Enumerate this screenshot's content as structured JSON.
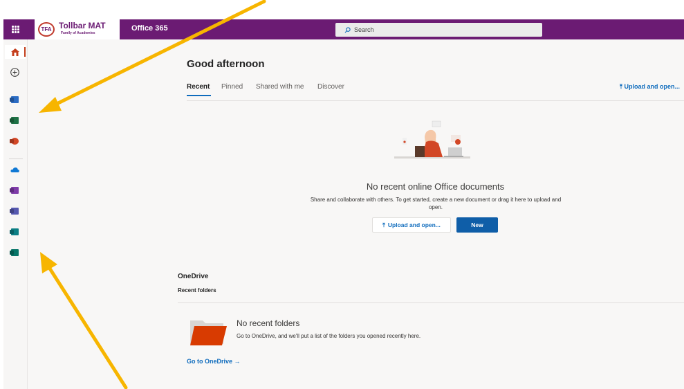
{
  "topbar": {
    "org_logo_text": "TFA",
    "org_name": "Tollbar MAT",
    "org_tagline": "Family of Academies",
    "app_name": "Office 365",
    "search_placeholder": "Search",
    "bar_color": "#6b1b73"
  },
  "rail": {
    "items": [
      {
        "name": "home",
        "icon": "home-icon",
        "color": "#c43e1c"
      },
      {
        "name": "create",
        "icon": "add-circle-icon",
        "color": "#323130"
      },
      {
        "name": "word",
        "icon": "word-icon",
        "color": "#2b6cc4"
      },
      {
        "name": "excel",
        "icon": "excel-icon",
        "color": "#1e7145"
      },
      {
        "name": "powerpoint",
        "icon": "powerpoint-icon",
        "color": "#d24726"
      },
      {
        "name": "onedrive",
        "icon": "onedrive-icon",
        "color": "#0f78d4"
      },
      {
        "name": "onenote",
        "icon": "onenote-icon",
        "color": "#7e3ba8"
      },
      {
        "name": "teams",
        "icon": "teams-icon",
        "color": "#5558af"
      },
      {
        "name": "sway",
        "icon": "sway-icon",
        "color": "#0b7e84"
      },
      {
        "name": "publisher",
        "icon": "publisher-icon",
        "color": "#077568"
      }
    ]
  },
  "main": {
    "greeting": "Good afternoon",
    "tabs": [
      {
        "label": "Recent",
        "active": true
      },
      {
        "label": "Pinned",
        "active": false
      },
      {
        "label": "Shared with me",
        "active": false
      },
      {
        "label": "Discover",
        "active": false
      }
    ],
    "upload_link": "Upload and open...",
    "empty_title": "No recent online Office documents",
    "empty_desc": "Share and collaborate with others. To get started, create a new document or drag it here to upload and open.",
    "upload_button": "Upload and open...",
    "new_button": "New",
    "onedrive_title": "OneDrive",
    "recent_folders": "Recent folders",
    "no_folders_title": "No recent folders",
    "no_folders_desc": "Go to OneDrive, and we'll put a list of the folders you opened recently here.",
    "goto_onedrive": "Go to OneDrive"
  },
  "accent_color": "#0f6cbd",
  "annotation_color": "#f7b500"
}
